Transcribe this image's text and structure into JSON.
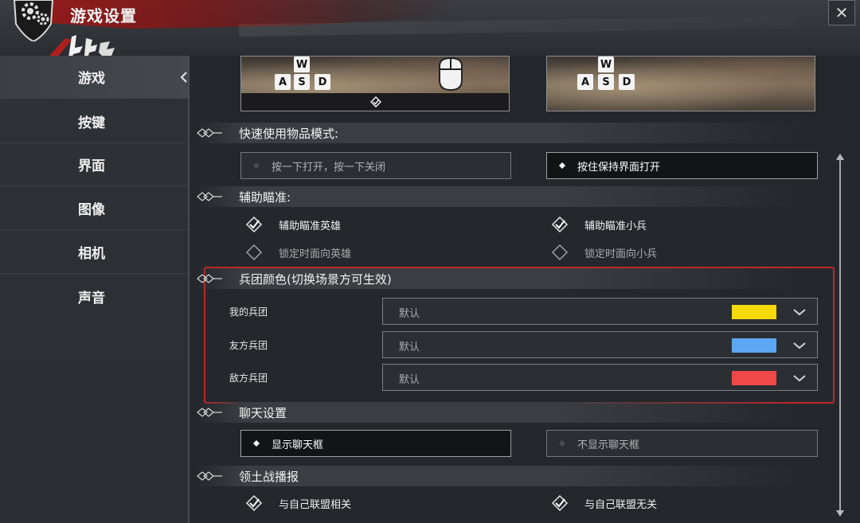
{
  "window": {
    "title": "游戏设置",
    "close_label": "✕"
  },
  "sidebar": {
    "items": [
      {
        "label": "游戏",
        "active": true
      },
      {
        "label": "按键",
        "active": false
      },
      {
        "label": "界面",
        "active": false
      },
      {
        "label": "图像",
        "active": false
      },
      {
        "label": "相机",
        "active": false
      },
      {
        "label": "声音",
        "active": false
      }
    ]
  },
  "preview": {
    "left": {
      "keys": [
        "W",
        "A",
        "S",
        "D"
      ]
    },
    "right": {
      "keys": [
        "W",
        "A",
        "S",
        "D"
      ]
    }
  },
  "quick_use": {
    "heading": "快速使用物品模式:",
    "options": [
      {
        "label": "按一下打开，按一下关闭",
        "selected": false
      },
      {
        "label": "按住保持界面打开",
        "selected": true
      }
    ]
  },
  "aim_assist": {
    "heading": "辅助瞄准:",
    "options": [
      {
        "label": "辅助瞄准英雄",
        "checked": true
      },
      {
        "label": "辅助瞄准小兵",
        "checked": true
      },
      {
        "label": "锁定时面向英雄",
        "checked": false
      },
      {
        "label": "锁定时面向小兵",
        "checked": false
      }
    ]
  },
  "army_colors": {
    "heading": "兵团颜色(切换场景方可生效)",
    "rows": [
      {
        "label": "我的兵团",
        "value": "默认",
        "color": "#f5d90a"
      },
      {
        "label": "友方兵团",
        "value": "默认",
        "color": "#5da6f2"
      },
      {
        "label": "敌方兵团",
        "value": "默认",
        "color": "#f04848"
      }
    ]
  },
  "chat": {
    "heading": "聊天设置",
    "options": [
      {
        "label": "显示聊天框",
        "selected": true
      },
      {
        "label": "不显示聊天框",
        "selected": false
      }
    ]
  },
  "territory": {
    "heading": "领土战播报",
    "options": [
      {
        "label": "与自己联盟相关",
        "checked": true
      },
      {
        "label": "与自己联盟无关",
        "checked": true
      }
    ]
  },
  "colors": {
    "highlight_frame": "#c0262b",
    "header_brush": "#961919"
  }
}
